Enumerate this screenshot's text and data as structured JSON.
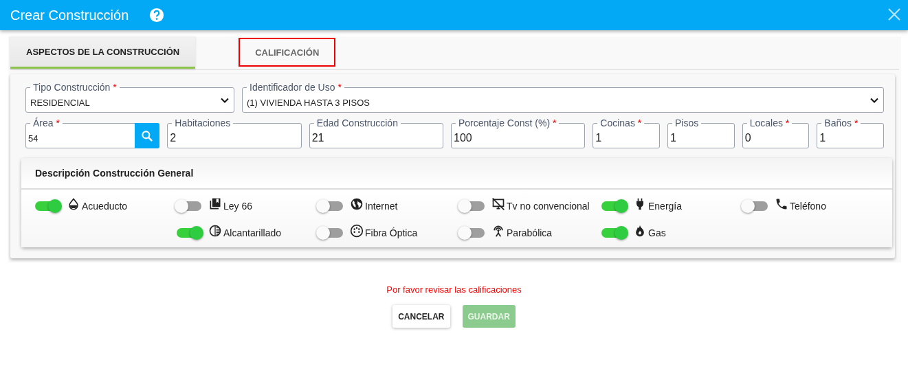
{
  "window": {
    "title": "Crear Construcción"
  },
  "tabs": [
    {
      "label": "ASPECTOS DE LA CONSTRUCCIÓN",
      "selected": true,
      "highlighted": false
    },
    {
      "label": "CALIFICACIÓN",
      "selected": false,
      "highlighted": true
    }
  ],
  "selects": [
    {
      "label": "Tipo Construcción",
      "required_mark": "*",
      "value": "RESIDENCIAL"
    },
    {
      "label": "Identificador de Uso",
      "required_mark": "*",
      "value": "(1) VIVIENDA HASTA 3 PISOS"
    }
  ],
  "fields": [
    {
      "label": "Área",
      "required_mark": "*",
      "value": "54",
      "kind": "search"
    },
    {
      "label": "Habitaciones",
      "value": "2",
      "kind": "wide"
    },
    {
      "label": "Edad Construcción",
      "value": "21",
      "kind": "wide"
    },
    {
      "label": "Porcentaje Const (%)",
      "required_mark": "*",
      "value": "100",
      "kind": "wide"
    },
    {
      "label": "Cocinas",
      "required_mark": "*",
      "value": "1",
      "kind": "narrow"
    },
    {
      "label": "Pisos",
      "value": "1",
      "kind": "narrow"
    },
    {
      "label": "Locales",
      "required_mark": "*",
      "value": "0",
      "kind": "narrow"
    },
    {
      "label": "Baños",
      "required_mark": "*",
      "value": "1",
      "kind": "narrow"
    }
  ],
  "panel": {
    "title": "Descripción Construcción General",
    "columns": [
      {
        "items": [
          {
            "label": "Acueducto",
            "kind": "water",
            "on": true
          }
        ]
      },
      {
        "items": [
          {
            "label": "Ley 66",
            "kind": "law",
            "on": false
          },
          {
            "label": "Alcantarillado",
            "kind": "sewer",
            "on": true
          }
        ]
      },
      {
        "items": [
          {
            "label": "Internet",
            "kind": "internet",
            "on": false
          },
          {
            "label": "Fibra Óptica",
            "kind": "fiber",
            "on": false
          }
        ]
      },
      {
        "items": [
          {
            "label": "Tv no convencional",
            "kind": "tv",
            "on": false
          },
          {
            "label": "Parabólica",
            "kind": "dish",
            "on": false
          }
        ]
      },
      {
        "items": [
          {
            "label": "Energía",
            "kind": "power",
            "on": true
          },
          {
            "label": "Gas",
            "kind": "gas",
            "on": true
          }
        ]
      },
      {
        "items": [
          {
            "label": "Teléfono",
            "kind": "phone",
            "on": false
          }
        ]
      }
    ]
  },
  "message": "Por favor revisar las calificaciones",
  "buttons": [
    {
      "label": "CANCELAR",
      "disabled": false
    },
    {
      "label": "GUARDAR",
      "disabled": true
    }
  ]
}
